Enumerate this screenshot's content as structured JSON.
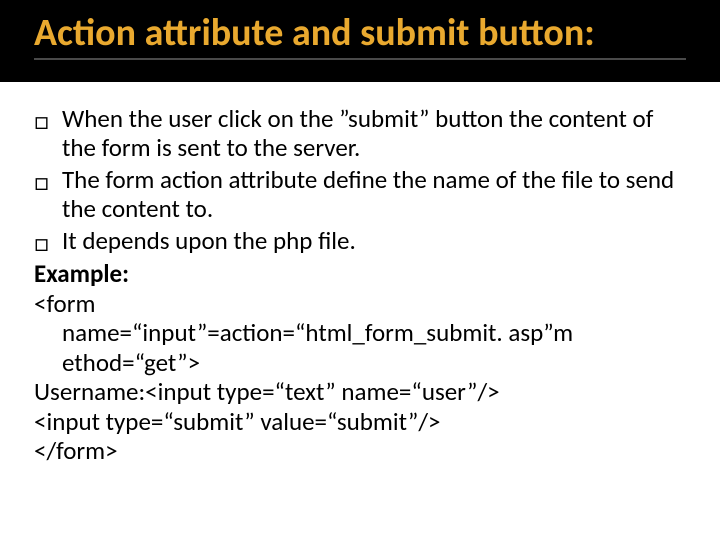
{
  "title": "Action attribute and submit button:",
  "bullets": [
    "When the user click on the ”submit”  button the content of the form is sent to the server.",
    "The form action attribute define the name of the file  to send the content to.",
    "It depends upon the php file."
  ],
  "example_label": "Example:",
  "code": {
    "l1": "<form",
    "l2": "name=“input”=action=“html_form_submit. asp”m",
    "l3": "ethod=“get”>",
    "l4": "Username:<input type=“text” name=“user”/>",
    "l5": "<input type=“submit” value=“submit”/>",
    "l6": "</form>"
  }
}
